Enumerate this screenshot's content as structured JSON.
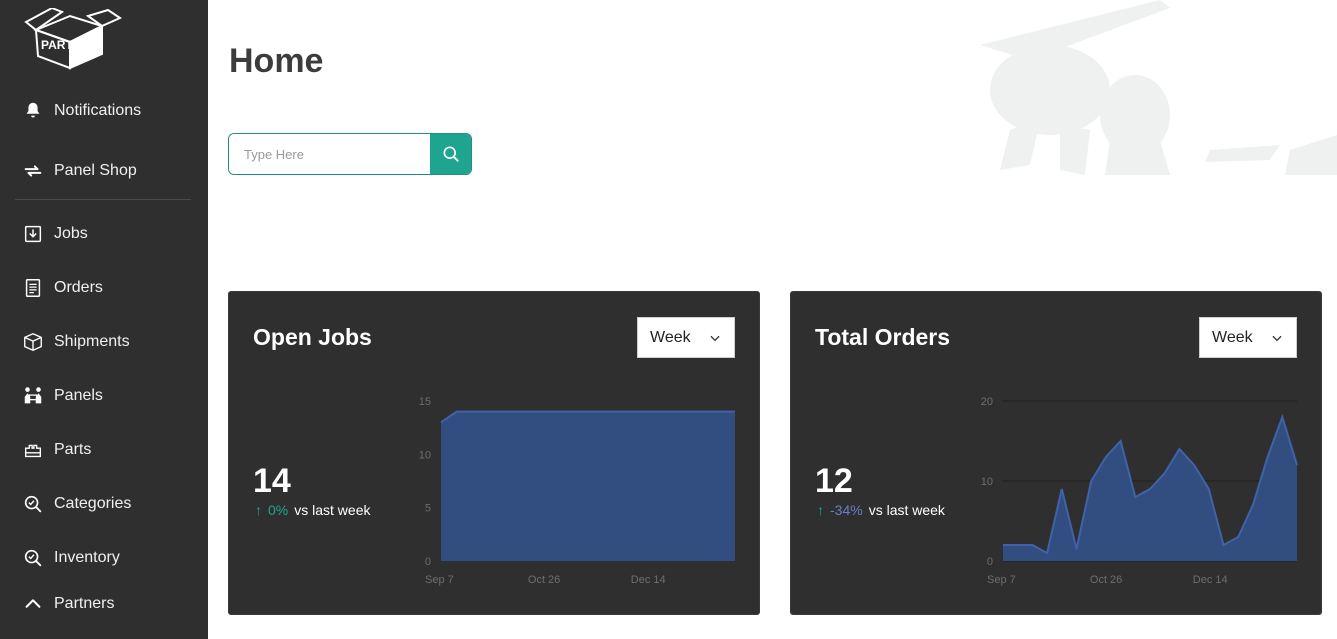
{
  "brand": {
    "logo_text": "PARTR"
  },
  "sidebar": {
    "items": [
      {
        "label": "Notifications",
        "icon": "bell-icon"
      },
      {
        "label": "Panel Shop",
        "icon": "swap-icon"
      },
      {
        "label": "Jobs",
        "icon": "download-icon"
      },
      {
        "label": "Orders",
        "icon": "document-icon"
      },
      {
        "label": "Shipments",
        "icon": "box-icon"
      },
      {
        "label": "Panels",
        "icon": "people-icon"
      },
      {
        "label": "Parts",
        "icon": "parts-icon"
      },
      {
        "label": "Categories",
        "icon": "search-check-icon"
      },
      {
        "label": "Inventory",
        "icon": "search-check-icon"
      },
      {
        "label": "Partners",
        "icon": "chevron-up-icon"
      }
    ]
  },
  "header": {
    "title": "Home"
  },
  "search": {
    "placeholder": "Type Here",
    "value": ""
  },
  "colors": {
    "accent": "#1fa58f",
    "card_bg": "#2f2f2f",
    "sidebar_bg": "#2f2f2f",
    "chart_fill": "#324e80",
    "chart_line": "#3f62a8"
  },
  "cards": [
    {
      "title": "Open Jobs",
      "dropdown": "Week",
      "value": "14",
      "delta": "0%",
      "delta_suffix": "vs last week",
      "chart_data": {
        "type": "area",
        "x_tick_labels": [
          "Sep 7",
          "Oct 26",
          "Dec 14"
        ],
        "y_ticks": [
          0,
          5,
          10,
          15
        ],
        "ylim": [
          0,
          15
        ],
        "values": [
          13,
          14,
          14,
          14,
          14,
          14,
          14,
          14,
          14,
          14,
          14,
          14,
          14,
          14,
          14,
          14,
          14,
          14,
          14,
          14
        ],
        "grid": false
      }
    },
    {
      "title": "Total Orders",
      "dropdown": "Week",
      "value": "12",
      "delta": "-34%",
      "delta_suffix": "vs last week",
      "chart_data": {
        "type": "area",
        "x_tick_labels": [
          "Sep 7",
          "Oct 26",
          "Dec 14"
        ],
        "y_ticks": [
          0,
          10,
          20
        ],
        "ylim": [
          0,
          20
        ],
        "values": [
          2,
          2,
          2,
          1,
          9,
          1.5,
          10,
          13,
          15,
          8,
          9,
          11,
          14,
          12,
          9,
          2,
          3,
          7,
          13,
          18,
          12
        ],
        "grid": true
      }
    }
  ]
}
